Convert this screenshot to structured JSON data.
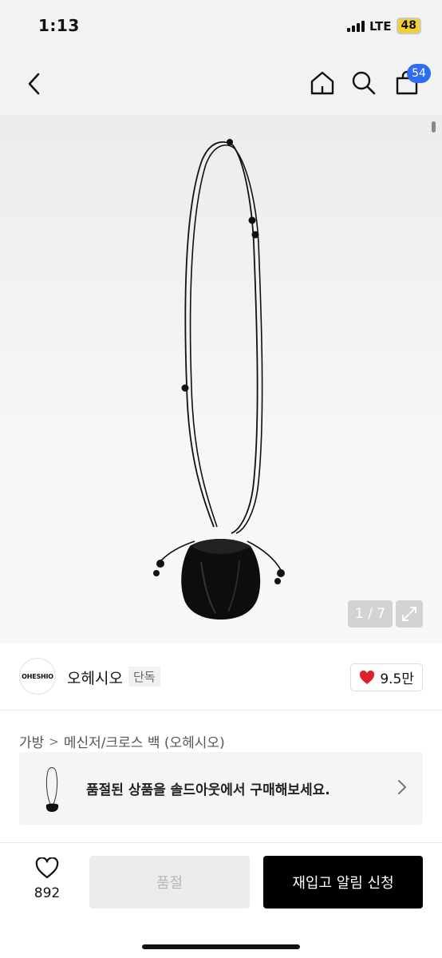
{
  "status_bar": {
    "time": "1:13",
    "network": "LTE",
    "battery": "48"
  },
  "nav": {
    "cart_badge": "54"
  },
  "gallery": {
    "page_indicator": "1 / 7"
  },
  "brand": {
    "logo_text": "OHESHIO",
    "name": "오헤시오",
    "exclusive_label": "단독",
    "like_count": "9.5만"
  },
  "breadcrumb": {
    "category": "가방",
    "separator": ">",
    "subcategory": "메신저/크로스 백 (오헤시오)"
  },
  "soldout_banner": {
    "text": "품절된 상품을 솔드아웃에서 구매해보세요."
  },
  "bottom_bar": {
    "wish_count": "892",
    "soldout_label": "품절",
    "restock_label": "재입고 알림 신청"
  },
  "colors": {
    "accent_badge": "#2c6df3",
    "heart": "#e0202a",
    "primary_button": "#000000"
  }
}
